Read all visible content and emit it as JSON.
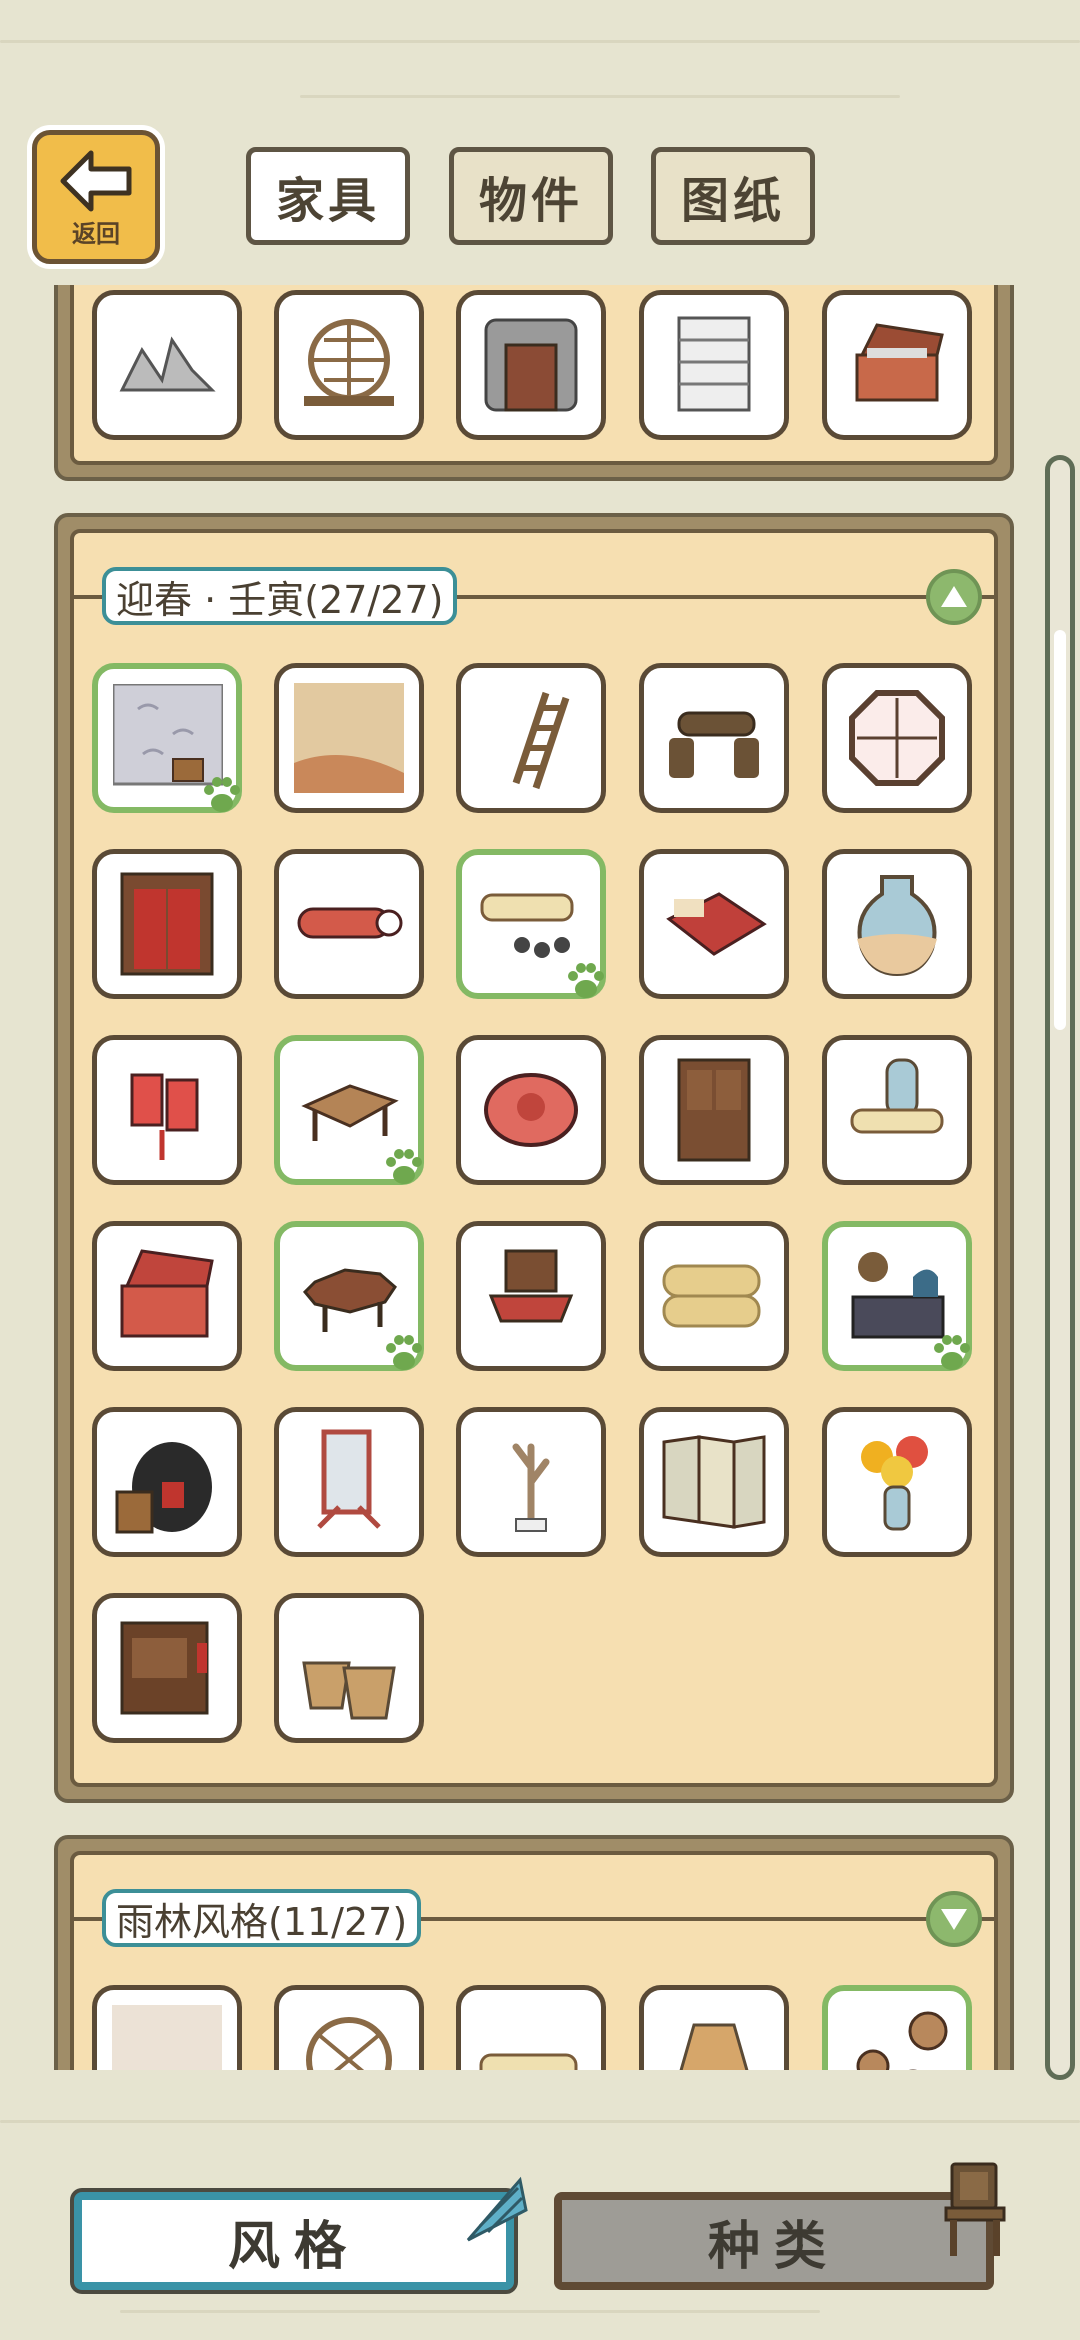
{
  "back_button": {
    "label": "返回"
  },
  "tabs": [
    {
      "label": "家具",
      "active": true
    },
    {
      "label": "物件",
      "active": false
    },
    {
      "label": "图纸",
      "active": false
    }
  ],
  "sections": [
    {
      "title": "",
      "collapsed": false,
      "items": [
        {
          "icon": "rocks-icon",
          "owned": false
        },
        {
          "icon": "round-lattice-window-icon",
          "owned": false
        },
        {
          "icon": "stone-gate-icon",
          "owned": false
        },
        {
          "icon": "shelf-stand-icon",
          "owned": false
        },
        {
          "icon": "open-chest-icon",
          "owned": false
        }
      ]
    },
    {
      "title": "迎春 · 壬寅(27/27)",
      "collapsed": false,
      "items": [
        {
          "icon": "wall-scroll-icon",
          "owned": true
        },
        {
          "icon": "floor-mat-icon",
          "owned": false
        },
        {
          "icon": "ladder-icon",
          "owned": false
        },
        {
          "icon": "log-bench-icon",
          "owned": false
        },
        {
          "icon": "octagon-window-icon",
          "owned": false
        },
        {
          "icon": "red-door-icon",
          "owned": false
        },
        {
          "icon": "red-scrolls-icon",
          "owned": false
        },
        {
          "icon": "scroll-stones-icon",
          "owned": true
        },
        {
          "icon": "red-bed-icon",
          "owned": false
        },
        {
          "icon": "vase-icon",
          "owned": false
        },
        {
          "icon": "red-charm-icon",
          "owned": false
        },
        {
          "icon": "low-table-icon",
          "owned": true
        },
        {
          "icon": "red-cushion-icon",
          "owned": false
        },
        {
          "icon": "wood-cabinet-icon",
          "owned": false
        },
        {
          "icon": "paper-scrolls-icon",
          "owned": false
        },
        {
          "icon": "red-chest-icon",
          "owned": false
        },
        {
          "icon": "octagon-table-icon",
          "owned": true
        },
        {
          "icon": "red-chair-icon",
          "owned": false
        },
        {
          "icon": "straw-mats-icon",
          "owned": false
        },
        {
          "icon": "tea-stove-icon",
          "owned": true
        },
        {
          "icon": "wine-jar-icon",
          "owned": false
        },
        {
          "icon": "mirror-stand-icon",
          "owned": false
        },
        {
          "icon": "branch-stand-icon",
          "owned": false
        },
        {
          "icon": "folding-screen-icon",
          "owned": false
        },
        {
          "icon": "flower-vase-icon",
          "owned": false
        },
        {
          "icon": "small-cabinet-icon",
          "owned": false
        },
        {
          "icon": "baskets-icon",
          "owned": false
        }
      ]
    },
    {
      "title": "雨林风格(11/27)",
      "collapsed": true,
      "items": [
        {
          "icon": "paper-panel-icon",
          "owned": false
        },
        {
          "icon": "round-window-icon",
          "owned": false
        },
        {
          "icon": "scroll-icon",
          "owned": false
        },
        {
          "icon": "lamp-shade-icon",
          "owned": false
        },
        {
          "icon": "stones-icon",
          "owned": true
        }
      ]
    }
  ],
  "bottom_buttons": {
    "style_label": "风格",
    "category_label": "种类"
  },
  "colors": {
    "accent_teal": "#3a93a7",
    "owned_green": "#84b964",
    "panel_bg": "#f6dfb1",
    "page_bg": "#e6e4d0"
  }
}
